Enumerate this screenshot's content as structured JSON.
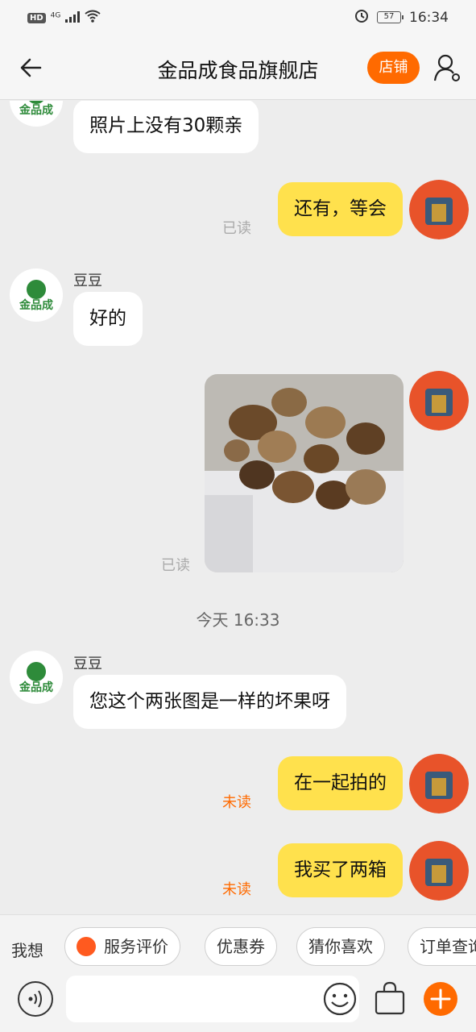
{
  "status_bar": {
    "hd": "HD",
    "network": "4G",
    "battery": "57",
    "time": "16:34"
  },
  "header": {
    "title": "金品成食品旗舰店",
    "store_label": "店铺"
  },
  "shop_avatar_text": "金品成",
  "messages": [
    {
      "from": "shop",
      "text": "照片上没有30颗亲"
    },
    {
      "from": "me",
      "text": "还有，等会",
      "status": "已读"
    },
    {
      "from": "shop",
      "sender": "豆豆",
      "text": "好的"
    },
    {
      "from": "me",
      "type": "image",
      "status": "已读"
    },
    {
      "type": "time",
      "text": "今天  16:33"
    },
    {
      "from": "shop",
      "sender": "豆豆",
      "text": "您这个两张图是一样的坏果呀"
    },
    {
      "from": "me",
      "text": "在一起拍的",
      "status": "未读"
    },
    {
      "from": "me",
      "text": "我买了两箱",
      "status": "未读"
    }
  ],
  "quick_replies": {
    "label": "我想",
    "items": [
      "服务评价",
      "优惠券",
      "猜你喜欢",
      "订单查询"
    ]
  },
  "input": {
    "placeholder": ""
  },
  "colors": {
    "accent": "#ff6a00",
    "bubble_out": "#ffe14d",
    "background": "#ededed"
  }
}
